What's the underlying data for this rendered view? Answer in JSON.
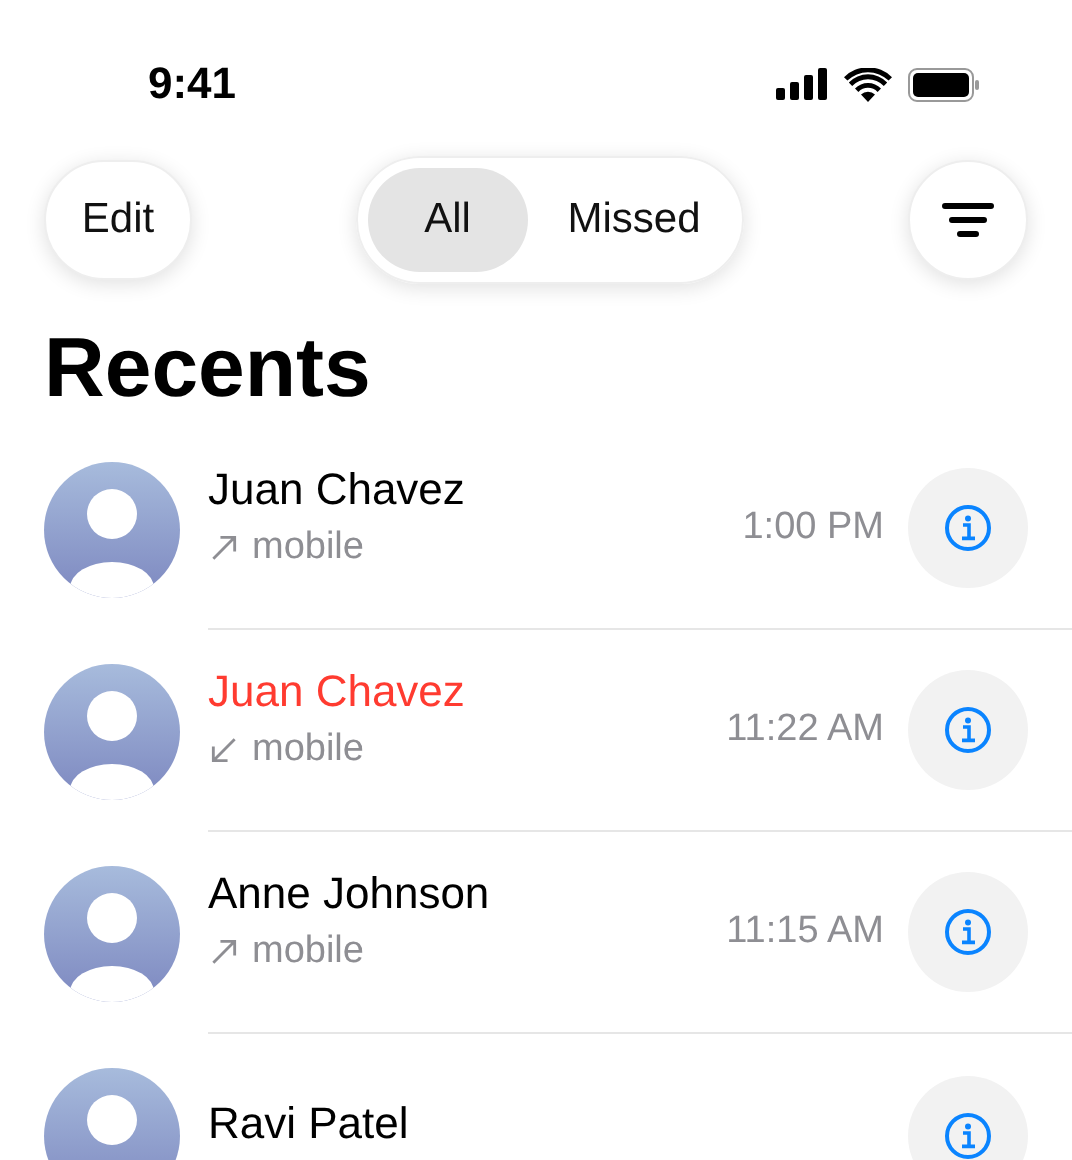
{
  "status_bar": {
    "time": "9:41"
  },
  "toolbar": {
    "edit": "Edit",
    "filters": [
      {
        "label": "All",
        "selected": true
      },
      {
        "label": "Missed",
        "selected": false
      }
    ]
  },
  "title": "Recents",
  "calls": [
    {
      "name": "Juan Chavez",
      "missed": false,
      "kind": "outgoing",
      "type": "mobile",
      "time": "1:00 PM"
    },
    {
      "name": "Juan Chavez",
      "missed": true,
      "kind": "incoming",
      "type": "mobile",
      "time": "11:22 AM"
    },
    {
      "name": "Anne Johnson",
      "missed": false,
      "kind": "outgoing",
      "type": "mobile",
      "time": "11:15 AM"
    },
    {
      "name": "Ravi Patel",
      "missed": false
    }
  ]
}
